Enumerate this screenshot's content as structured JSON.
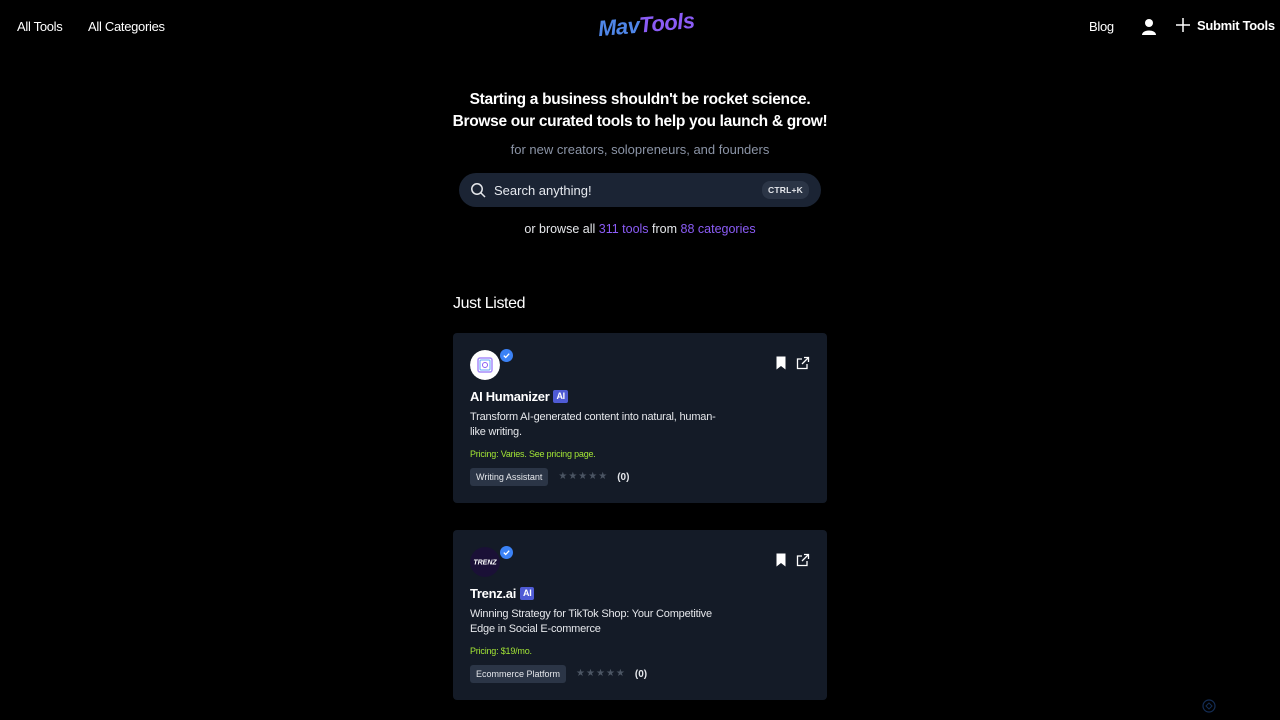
{
  "nav": {
    "all_tools": "All Tools",
    "all_categories": "All Categories",
    "logo_part1": "Mav",
    "logo_part2": "Tools",
    "blog": "Blog",
    "user_icon": "user-icon",
    "submit_label": "Submit Tools"
  },
  "hero": {
    "title_line1": "Starting a business shouldn't be rocket science.",
    "title_line2": "Browse our curated tools to help you launch & grow!",
    "subtitle": "for new creators, solopreneurs, and founders"
  },
  "search": {
    "placeholder": "Search anything!",
    "shortcut": "CTRL+K"
  },
  "browse": {
    "prefix": "or browse all ",
    "tools_link": "311 tools",
    "middle": " from ",
    "categories_link": "88 categories"
  },
  "section": {
    "title": "Just Listed"
  },
  "cards": [
    {
      "name": "AI Humanizer",
      "badge": "AI",
      "description": "Transform AI-generated content into natural, human-like writing.",
      "pricing": "Pricing: Varies. See pricing page.",
      "tag": "Writing Assistant",
      "rating": 0,
      "review_count": "(0)"
    },
    {
      "name": "Trenz.ai",
      "badge": "AI",
      "description": "Winning Strategy for TikTok Shop: Your Competitive Edge in Social E-commerce",
      "pricing": "Pricing: $19/mo.",
      "tag": "Ecommerce Platform",
      "rating": 0,
      "review_count": "(0)",
      "logo_text": "TRENZ"
    }
  ],
  "colors": {
    "background": "#000000",
    "card": "#141b27",
    "accent": "#8b5cf6",
    "pricing": "#a3e635"
  }
}
